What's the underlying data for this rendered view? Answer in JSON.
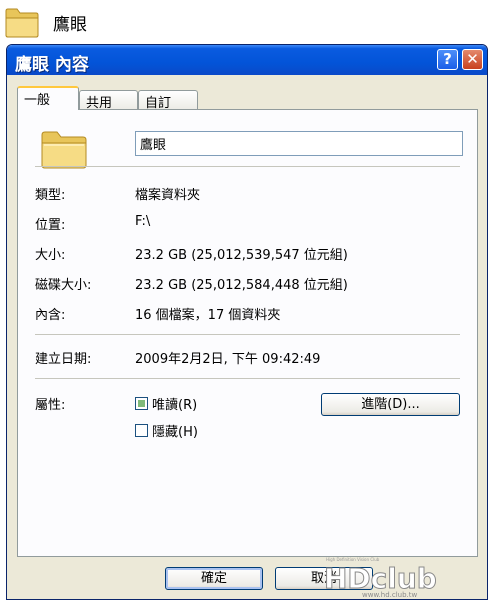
{
  "desktop": {
    "folder_label": "鷹眼"
  },
  "window": {
    "title": "鷹眼 內容",
    "help_label": "?",
    "close_label": "✕"
  },
  "tabs": [
    {
      "label": "一般",
      "active": true
    },
    {
      "label": "共用",
      "active": false
    },
    {
      "label": "自訂",
      "active": false
    }
  ],
  "general": {
    "folder_name": "鷹眼",
    "properties": [
      {
        "label": "類型:",
        "value": "檔案資料夾"
      },
      {
        "label": "位置:",
        "value": "F:\\"
      },
      {
        "label": "大小:",
        "value": "23.2 GB (25,012,539,547 位元組)"
      },
      {
        "label": "磁碟大小:",
        "value": "23.2 GB (25,012,584,448 位元組)"
      },
      {
        "label": "內含:",
        "value": "16 個檔案，17 個資料夾"
      }
    ],
    "created": {
      "label": "建立日期:",
      "value": "2009年2月2日, 下午 09:42:49"
    },
    "attributes": {
      "label": "屬性:",
      "readonly_label": "唯讀(R)",
      "readonly_checked": true,
      "hidden_label": "隱藏(H)",
      "hidden_checked": false,
      "advanced_label": "進階(D)..."
    }
  },
  "buttons": {
    "ok": "確定",
    "cancel": "取消"
  },
  "watermark": {
    "logo_text": "HDclub",
    "tagline": "High Definition Vision Club",
    "url": "www.hd.club.tw"
  },
  "colors": {
    "titlebar": "#0354d8",
    "dialog_bg": "#ece9d8",
    "tab_accent": "#ffc83c"
  }
}
